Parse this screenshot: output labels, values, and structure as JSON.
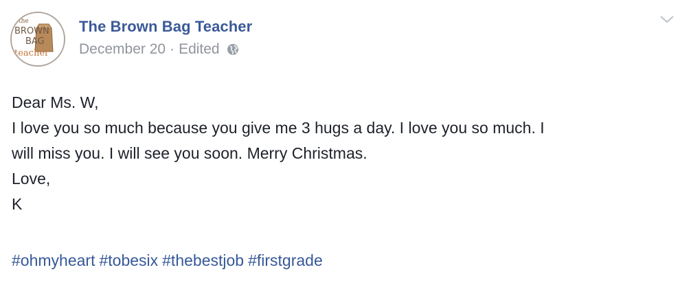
{
  "post": {
    "page_name": "The Brown Bag Teacher",
    "date": "December 20",
    "separator": "·",
    "edited_label": "Edited",
    "privacy_icon": "globe-icon",
    "menu_icon": "chevron-down-icon",
    "avatar": {
      "logo_text_top": "the",
      "logo_text_middle": "BROWN",
      "logo_text_bag": "BAG",
      "logo_text_bottom": "teacher"
    },
    "message_lines": [
      "Dear Ms. W,",
      "I love you so much because you give me 3 hugs a day. I love you so much. I",
      "will miss you. I will see you soon. Merry Christmas.",
      "Love,",
      "K"
    ],
    "hashtags": [
      "#ohmyheart",
      "#tobesix",
      "#thebestjob",
      "#firstgrade"
    ]
  },
  "colors": {
    "link_blue": "#3b5998",
    "meta_gray": "#90949c",
    "text": "#1d2129",
    "hashtag_blue": "#365899"
  }
}
